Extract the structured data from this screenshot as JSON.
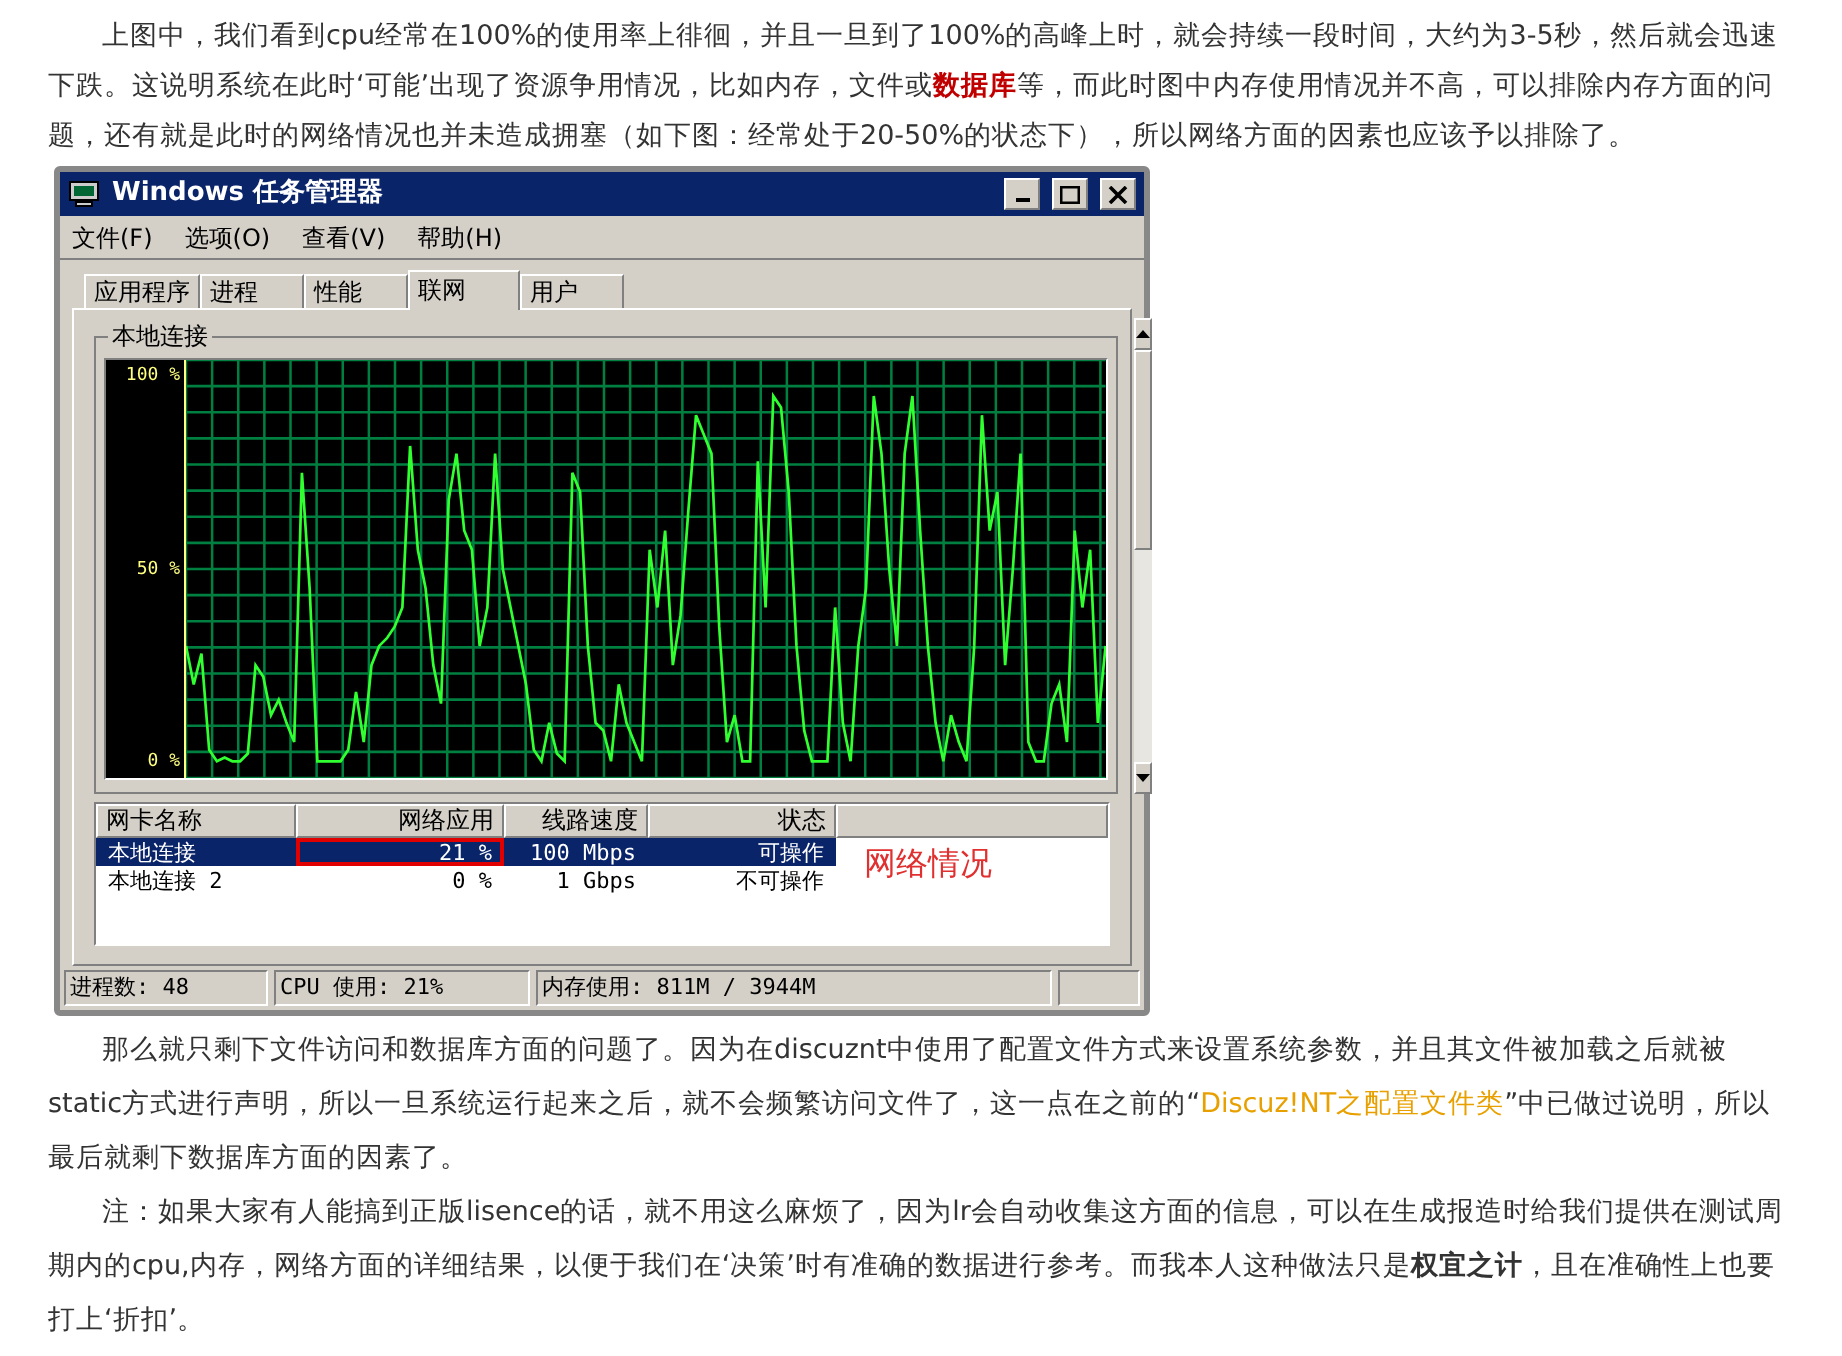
{
  "intro": "上图中，我们看到cpu经常在100%的使用率上徘徊，并且一旦到了100%的高峰上时，就会持续一段时间，大约为3-5秒，然后就会迅速下跌。这说明系统在此时‘可能’出现了资源争用情况，比如内存，文件或**数据库**等，而此时图中内存使用情况并不高，可以排除内存方面的问题，还有就是此时的网络情况也并未造成拥塞（如下图：经常处于20-50%的状态下），所以网络方面的因素也应该予以排除了。",
  "window": {
    "title": "Windows 任务管理器",
    "menu": [
      "文件(F)",
      "选项(O)",
      "查看(V)",
      "帮助(H)"
    ],
    "tabs": [
      {
        "label": "应用程序",
        "selected": false
      },
      {
        "label": "进程",
        "selected": false
      },
      {
        "label": "性能",
        "selected": false
      },
      {
        "label": "联网",
        "selected": true
      },
      {
        "label": "用户",
        "selected": false
      }
    ],
    "group_label": "本地连接",
    "chart_data": {
      "type": "line",
      "ylim": [
        -4.35,
        104.35
      ],
      "yticks": [
        {
          "value": 100,
          "label": "100 %"
        },
        {
          "value": 50,
          "label": "50 %"
        },
        {
          "value": 0,
          "label": "0 %"
        }
      ],
      "series": [
        {
          "color": "#30ff30",
          "values": [
            30,
            20,
            28,
            3,
            0,
            1,
            0,
            0,
            2,
            25,
            22,
            12,
            16,
            10,
            5,
            75,
            45,
            0,
            0,
            0,
            0,
            3,
            18,
            5,
            25,
            30,
            32,
            35,
            40,
            82,
            55,
            45,
            25,
            15,
            68,
            80,
            60,
            55,
            30,
            40,
            80,
            50,
            40,
            30,
            20,
            3,
            0,
            10,
            2,
            0,
            75,
            70,
            30,
            10,
            8,
            0,
            20,
            10,
            5,
            0,
            55,
            40,
            60,
            25,
            38,
            65,
            90,
            85,
            80,
            35,
            5,
            12,
            0,
            0,
            78,
            40,
            95,
            92,
            70,
            30,
            8,
            0,
            0,
            0,
            40,
            10,
            0,
            30,
            45,
            95,
            80,
            50,
            30,
            80,
            95,
            60,
            30,
            10,
            0,
            12,
            5,
            0,
            30,
            90,
            60,
            70,
            25,
            50,
            80,
            5,
            0,
            0,
            15,
            20,
            5,
            60,
            40,
            55,
            10,
            30
          ]
        }
      ]
    },
    "adapters": {
      "columns": [
        "网卡名称",
        "网络应用",
        "线路速度",
        "状态"
      ],
      "rows": [
        {
          "selected": true,
          "cells": [
            {
              "text": "本地连接",
              "boxed": false
            },
            {
              "text": "21 %",
              "boxed": true
            },
            {
              "text": "100 Mbps",
              "boxed": false
            },
            {
              "text": "可操作",
              "boxed": false
            }
          ]
        },
        {
          "selected": false,
          "cells": [
            {
              "text": "本地连接 2",
              "boxed": false
            },
            {
              "text": "0 %",
              "boxed": false
            },
            {
              "text": "1 Gbps",
              "boxed": false
            },
            {
              "text": "不可操作",
              "boxed": false
            }
          ]
        }
      ]
    },
    "annotation": "网络情况",
    "status_bar": [
      "进程数: 48",
      "CPU 使用: 21%",
      "内存使用: 811M / 3944M"
    ]
  },
  "para2": {
    "before": "那么就只剩下文件访问和数据库方面的问题了。因为在discuznt中使用了配置文件方式来设置系统参数，并且其文件被加载之后就被static方式进行声明，所以一旦系统运行起来之后，就不会频繁访问文件了，这一点在之前的“",
    "link": "Discuz!NT之配置文件类",
    "after": "”中已做过说明，所以最后就剩下数据库方面的因素了。"
  },
  "para3": "注：如果大家有人能搞到正版lisence的话，就不用这么麻烦了，因为lr会自动收集这方面的信息，可以在生成报造时给我们提供在测试周期内的cpu,内存，网络方面的详细结果，以便于我们在‘决策’时有准确的数据进行参考。而我本人这种做法只是**权宜之计**，且在准确性上也要打上‘折扣’。"
}
